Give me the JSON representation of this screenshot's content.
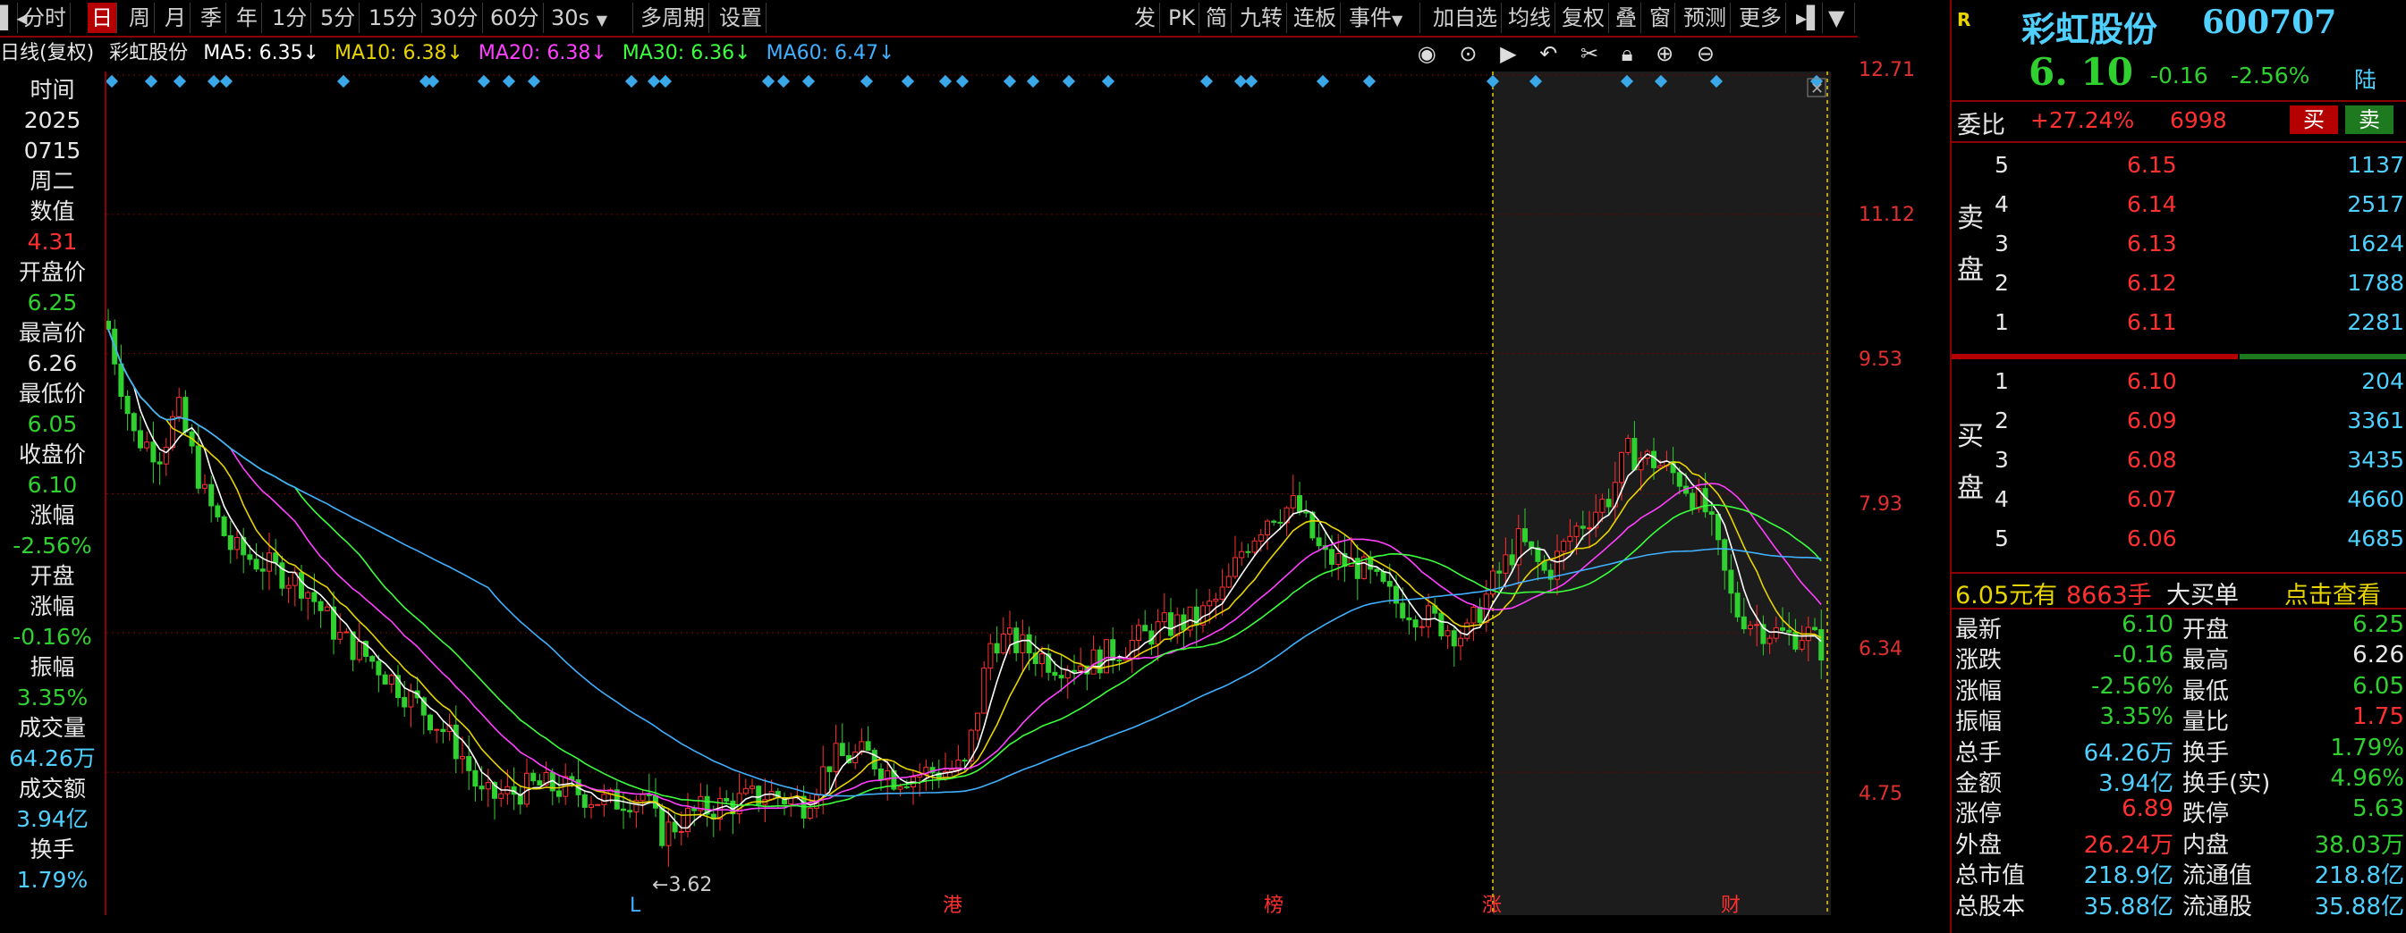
{
  "toolbar": {
    "items": [
      "分时",
      "日",
      "周",
      "月",
      "季",
      "年",
      "1分",
      "5分",
      "15分",
      "30分",
      "60分",
      "30s",
      "多周期",
      "设置"
    ],
    "right_items": [
      "发",
      "PK",
      "简",
      "九转",
      "连板",
      "事件",
      "加自选",
      "均线",
      "复权",
      "叠",
      "窗",
      "预测",
      "更多"
    ]
  },
  "ma": {
    "prefix": "日线(复权)",
    "name": "彩虹股份",
    "ma5": "MA5: 6.35↓",
    "ma10": "MA10: 6.38↓",
    "ma20": "MA20: 6.38↓",
    "ma30": "MA30: 6.36↓",
    "ma60": "MA60: 6.47↓"
  },
  "left": {
    "time_label": "时间",
    "year": "2025",
    "date": "0715",
    "weekday": "周二",
    "value_label": "数值",
    "value": "4.31",
    "open_label": "开盘价",
    "open": "6.25",
    "high_label": "最高价",
    "high": "6.26",
    "low_label": "最低价",
    "low": "6.05",
    "close_label": "收盘价",
    "close": "6.10",
    "chg_label": "涨幅",
    "chg": "-2.56%",
    "open_chg_label1": "开盘",
    "open_chg_label2": "涨幅",
    "open_chg": "-0.16%",
    "amp_label": "振幅",
    "amp": "3.35%",
    "vol_label": "成交量",
    "vol": "64.26万",
    "amt_label": "成交额",
    "amt": "3.94亿",
    "turn_label": "换手",
    "turn": "1.79%"
  },
  "price_axis": [
    "12.71",
    "11.12",
    "9.53",
    "7.93",
    "6.34",
    "4.75"
  ],
  "annotations": {
    "low_mark": "3.62",
    "markers": [
      "L",
      "港",
      "榜",
      "涨",
      "财"
    ]
  },
  "colors": {
    "up": "#ff3030",
    "down": "#2fd02f",
    "ma5": "#ffffff",
    "ma10": "#e8d400",
    "ma20": "#ff40ff",
    "ma30": "#3cff3c",
    "ma60": "#40b0ff"
  },
  "quote": {
    "badge": "R",
    "name": "彩虹股份",
    "code": "600707",
    "price": "6. 10",
    "change": "-0.16",
    "change_pct": "-2.56%",
    "market": "陆",
    "weibi_label": "委比",
    "weibi": "+27.24%",
    "weicha": "6998",
    "buy_btn": "买",
    "sell_btn": "卖",
    "sell_label": "卖盘",
    "buy_label": "买盘",
    "sell": [
      {
        "lvl": "5",
        "price": "6.15",
        "vol": "1137"
      },
      {
        "lvl": "4",
        "price": "6.14",
        "vol": "2517"
      },
      {
        "lvl": "3",
        "price": "6.13",
        "vol": "1624"
      },
      {
        "lvl": "2",
        "price": "6.12",
        "vol": "1788"
      },
      {
        "lvl": "1",
        "price": "6.11",
        "vol": "2281"
      }
    ],
    "buy": [
      {
        "lvl": "1",
        "price": "6.10",
        "vol": "204"
      },
      {
        "lvl": "2",
        "price": "6.09",
        "vol": "3361"
      },
      {
        "lvl": "3",
        "price": "6.08",
        "vol": "3435"
      },
      {
        "lvl": "4",
        "price": "6.07",
        "vol": "4660"
      },
      {
        "lvl": "5",
        "price": "6.06",
        "vol": "4685"
      }
    ],
    "bigorder_price": "6.05元有",
    "bigorder_vol": "8663手",
    "bigorder_text": "大买单",
    "bigorder_link": "点击查看",
    "stats": [
      {
        "l1": "最新",
        "v1": "6.10",
        "c1": "green",
        "l2": "开盘",
        "v2": "6.25",
        "c2": "green"
      },
      {
        "l1": "涨跌",
        "v1": "-0.16",
        "c1": "green",
        "l2": "最高",
        "v2": "6.26",
        "c2": "white"
      },
      {
        "l1": "涨幅",
        "v1": "-2.56%",
        "c1": "green",
        "l2": "最低",
        "v2": "6.05",
        "c2": "green"
      },
      {
        "l1": "振幅",
        "v1": "3.35%",
        "c1": "green",
        "l2": "量比",
        "v2": "1.75",
        "c2": "red"
      },
      {
        "l1": "总手",
        "v1": "64.26万",
        "c1": "cyan",
        "l2": "换手",
        "v2": "1.79%",
        "c2": "green"
      },
      {
        "l1": "金额",
        "v1": "3.94亿",
        "c1": "cyan",
        "l2": "换手(实)",
        "v2": "4.96%",
        "c2": "green"
      },
      {
        "l1": "涨停",
        "v1": "6.89",
        "c1": "red",
        "l2": "跌停",
        "v2": "5.63",
        "c2": "green"
      },
      {
        "l1": "外盘",
        "v1": "26.24万",
        "c1": "red",
        "l2": "内盘",
        "v2": "38.03万",
        "c2": "green"
      },
      {
        "l1": "总市值",
        "v1": "218.9亿",
        "c1": "cyan",
        "l2": "流通值",
        "v2": "218.8亿",
        "c2": "cyan"
      },
      {
        "l1": "总股本",
        "v1": "35.88亿",
        "c1": "cyan",
        "l2": "流通股",
        "v2": "35.88亿",
        "c2": "cyan"
      }
    ]
  }
}
